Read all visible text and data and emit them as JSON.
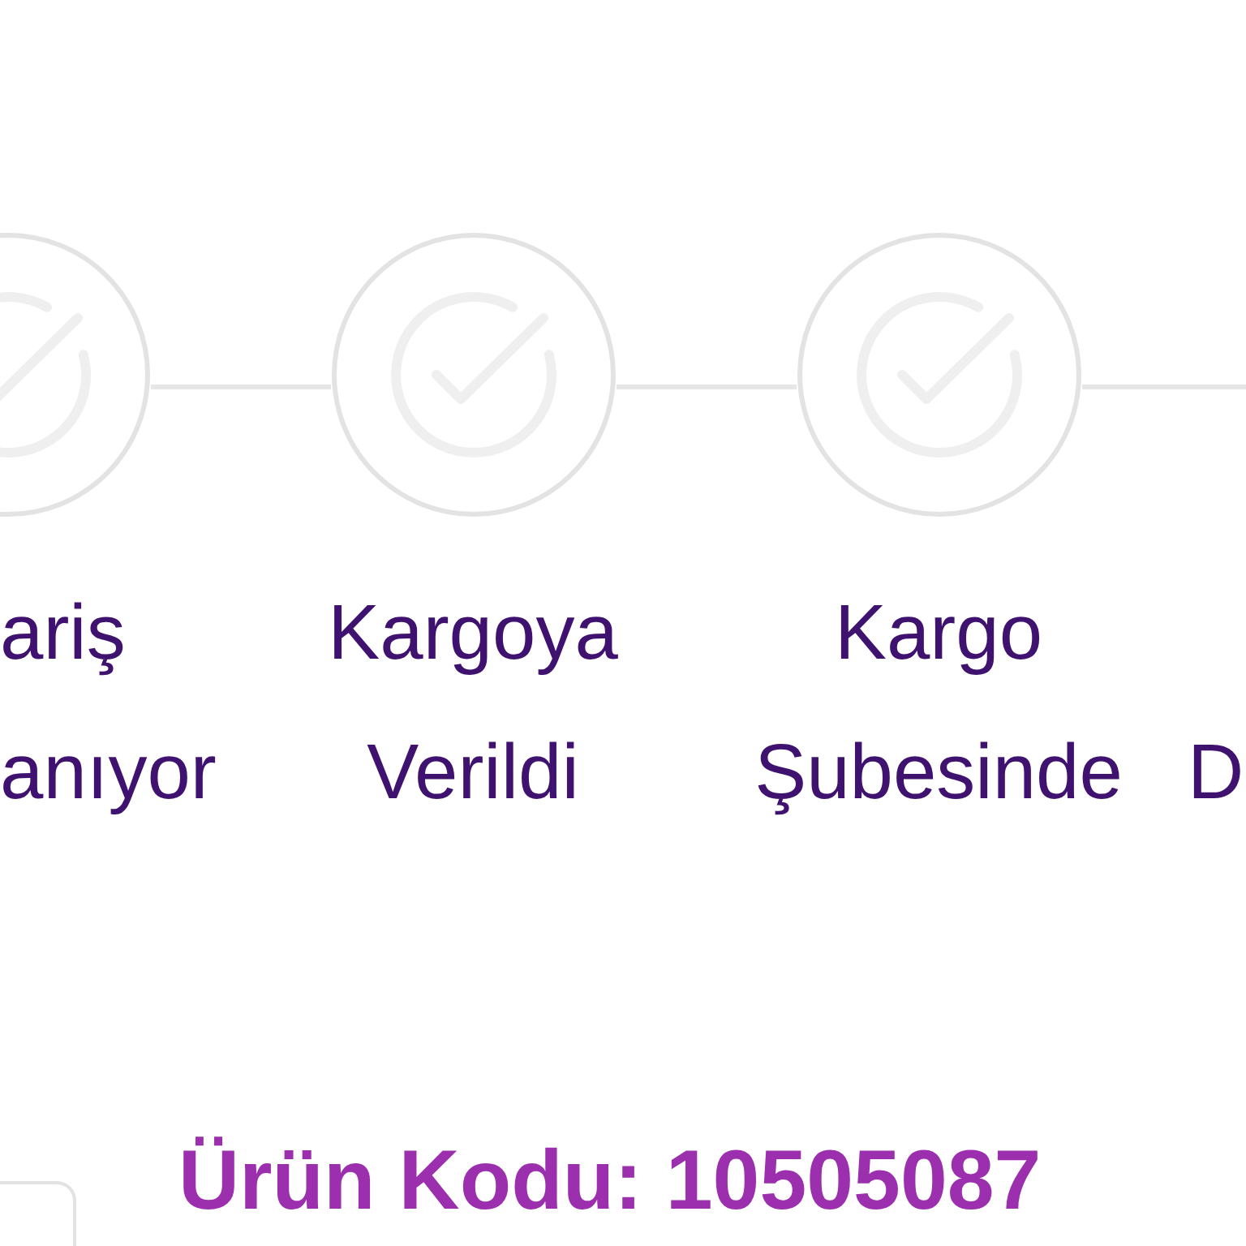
{
  "stepper": {
    "steps": [
      {
        "kind": "partial-start",
        "label": "ariş anıyor",
        "completed": false
      },
      {
        "kind": "full",
        "label": "Kargoya Verildi",
        "completed": false
      },
      {
        "kind": "full",
        "label": "Kargo Şubesinde",
        "completed": false
      },
      {
        "kind": "partial-end",
        "label": "D",
        "completed": false
      }
    ]
  },
  "product": {
    "code": "Ürün Kodu: 10505087"
  }
}
